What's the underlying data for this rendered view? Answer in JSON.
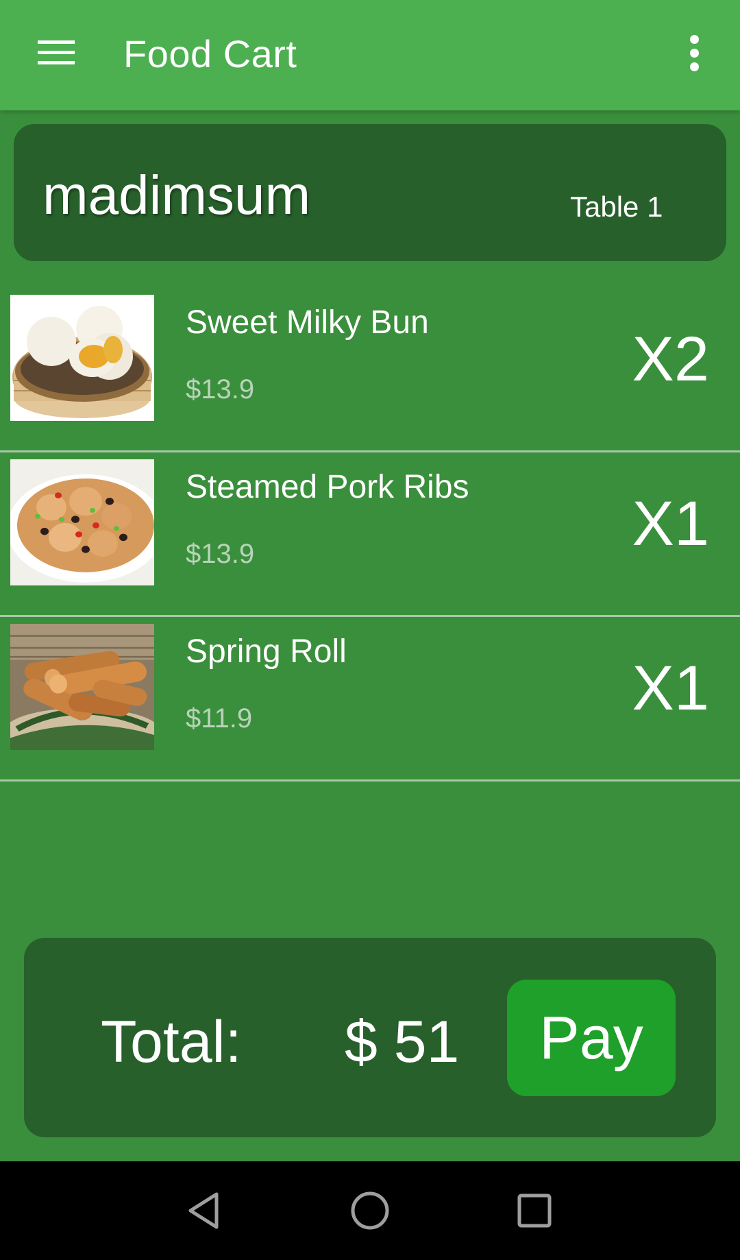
{
  "app_bar": {
    "title": "Food Cart",
    "menu_icon": "hamburger-menu-icon",
    "overflow_icon": "more-vert-icon"
  },
  "restaurant": {
    "name": "madimsum",
    "table": "Table 1"
  },
  "cart": {
    "items": [
      {
        "name": "Sweet Milky Bun",
        "price": "$13.9",
        "qty": "X2",
        "image": "steamed-bun-image"
      },
      {
        "name": "Steamed Pork Ribs",
        "price": "$13.9",
        "qty": "X1",
        "image": "pork-ribs-image"
      },
      {
        "name": "Spring Roll",
        "price": "$11.9",
        "qty": "X1",
        "image": "spring-roll-image"
      }
    ]
  },
  "footer": {
    "total_label": "Total:",
    "total_value": "$ 51",
    "pay_label": "Pay"
  },
  "nav": {
    "back_icon": "back-triangle-icon",
    "home_icon": "home-circle-icon",
    "recent_icon": "recent-apps-square-icon"
  },
  "colors": {
    "app_bar": "#4caf50",
    "background": "#3a8f3c",
    "panel": "#27602b",
    "pay_button": "#1ea02a"
  }
}
